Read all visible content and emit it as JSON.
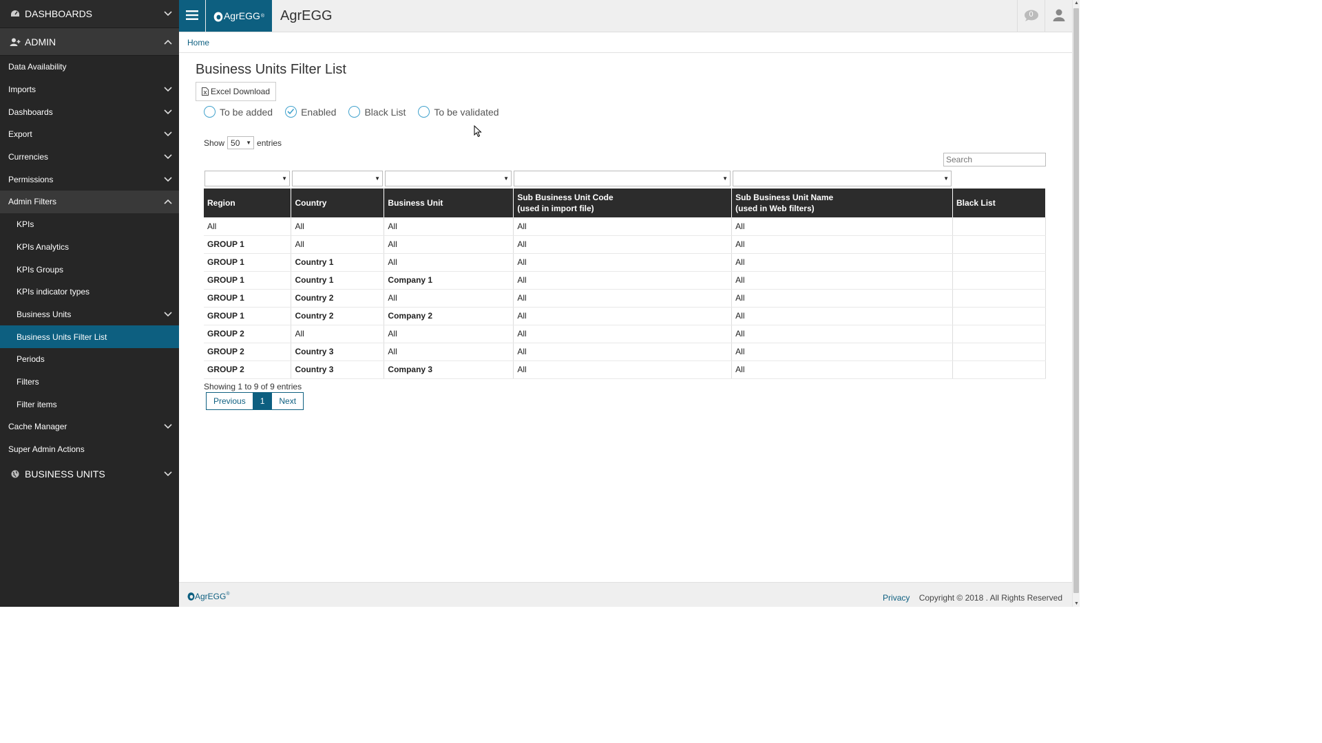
{
  "sidebar": {
    "dashboards_section": "DASHBOARDS",
    "admin_section": "ADMIN",
    "items": [
      {
        "label": "Data Availability"
      },
      {
        "label": "Imports"
      },
      {
        "label": "Dashboards"
      },
      {
        "label": "Export"
      },
      {
        "label": "Currencies"
      },
      {
        "label": "Permissions"
      },
      {
        "label": "Admin Filters"
      },
      {
        "label": "KPIs"
      },
      {
        "label": "KPIs Analytics"
      },
      {
        "label": "KPIs Groups"
      },
      {
        "label": "KPIs indicator types"
      },
      {
        "label": "Business Units"
      },
      {
        "label": "Business Units Filter List"
      },
      {
        "label": "Periods"
      },
      {
        "label": "Filters"
      },
      {
        "label": "Filter items"
      },
      {
        "label": "Cache Manager"
      },
      {
        "label": "Super Admin Actions"
      }
    ],
    "business_units_section": "BUSINESS UNITS"
  },
  "header": {
    "logo_text": "AgrEGG",
    "logo_mark": "®",
    "app_title": "AgrEGG",
    "notification_count": "0"
  },
  "breadcrumb": {
    "home": "Home"
  },
  "page": {
    "title": "Business Units Filter List",
    "excel_button": "Excel Download",
    "radios": [
      {
        "label": "To be added",
        "checked": false
      },
      {
        "label": "Enabled",
        "checked": true
      },
      {
        "label": "Black List",
        "checked": false
      },
      {
        "label": "To be validated",
        "checked": false
      }
    ],
    "show_label": "Show",
    "entries_value": "50",
    "entries_label": "entries",
    "search_placeholder": "Search"
  },
  "table": {
    "headers": [
      {
        "line1": "Region",
        "line2": ""
      },
      {
        "line1": "Country",
        "line2": ""
      },
      {
        "line1": "Business Unit",
        "line2": ""
      },
      {
        "line1": "Sub Business Unit Code",
        "line2": "(used in import file)"
      },
      {
        "line1": "Sub Business Unit Name",
        "line2": "(used in Web filters)"
      },
      {
        "line1": "Black List",
        "line2": ""
      }
    ],
    "rows": [
      [
        "All",
        "All",
        "All",
        "All",
        "All",
        ""
      ],
      [
        "GROUP 1",
        "All",
        "All",
        "All",
        "All",
        ""
      ],
      [
        "GROUP 1",
        "Country 1",
        "All",
        "All",
        "All",
        ""
      ],
      [
        "GROUP 1",
        "Country 1",
        "Company 1",
        "All",
        "All",
        ""
      ],
      [
        "GROUP 1",
        "Country 2",
        "All",
        "All",
        "All",
        ""
      ],
      [
        "GROUP 1",
        "Country 2",
        "Company 2",
        "All",
        "All",
        ""
      ],
      [
        "GROUP 2",
        "All",
        "All",
        "All",
        "All",
        ""
      ],
      [
        "GROUP 2",
        "Country 3",
        "All",
        "All",
        "All",
        ""
      ],
      [
        "GROUP 2",
        "Country 3",
        "Company 3",
        "All",
        "All",
        ""
      ]
    ]
  },
  "pagination": {
    "info": "Showing 1 to 9 of 9 entries",
    "previous": "Previous",
    "current": "1",
    "next": "Next"
  },
  "footer": {
    "logo_text": "AgrEGG",
    "logo_mark": "®",
    "privacy": "Privacy",
    "copyright": "Copyright © 2018 . All Rights Reserved"
  },
  "colors": {
    "accent": "#0d5f80",
    "sidebar_bg": "#262626",
    "table_header_bg": "#2c2c2c"
  }
}
